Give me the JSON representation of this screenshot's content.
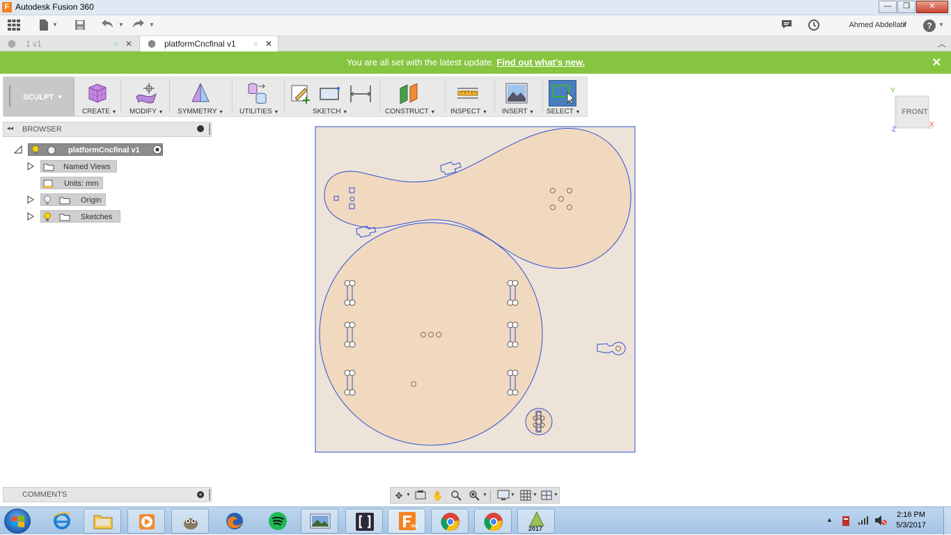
{
  "window": {
    "app_title": "Autodesk Fusion 360",
    "logo_letter": "F",
    "minimize": "—",
    "maximize": "❐",
    "close": "✕"
  },
  "qat": {
    "user_name": "Ahmed Abdellatif",
    "help": "?"
  },
  "tabs": [
    {
      "label": "1 v1",
      "active": false
    },
    {
      "label": "platformCncfinal v1",
      "active": true
    }
  ],
  "banner": {
    "message": "You are all set with the latest update.",
    "link": "Find out what's new.",
    "close": "✕"
  },
  "ribbon": {
    "workspace": "SCULPT",
    "groups": {
      "create": "CREATE",
      "modify": "MODIFY",
      "symmetry": "SYMMETRY",
      "utilities": "UTILITIES",
      "sketch": "SKETCH",
      "construct": "CONSTRUCT",
      "inspect": "INSPECT",
      "insert": "INSERT",
      "select": "SELECT"
    }
  },
  "browser": {
    "title": "BROWSER",
    "root": "platformCncfinal v1",
    "items": [
      {
        "label": "Named Views"
      },
      {
        "label": "Units: mm"
      },
      {
        "label": "Origin"
      },
      {
        "label": "Sketches"
      }
    ]
  },
  "comments": {
    "title": "COMMENTS"
  },
  "viewcube": {
    "face": "FRONT",
    "axis_y": "Y",
    "axis_x": "X",
    "axis_z": "Z"
  },
  "taskbar": {
    "time": "2:16 PM",
    "date": "5/3/2017",
    "version_badge": "2017",
    "fusion_badge": "360"
  },
  "colors": {
    "banner": "#87c540",
    "sketch_line": "#2e4fd4",
    "profile_fill": "#f1d9bf",
    "canvas_fill": "#ede3d8",
    "accent_orange": "#f58220"
  },
  "icons": [
    "apps-grid-icon",
    "file-icon",
    "save-icon",
    "undo-icon",
    "redo-icon",
    "notifications-icon",
    "history-icon",
    "help-icon",
    "orbit-icon",
    "pan-icon",
    "zoom-icon",
    "display-icon",
    "grid-icon"
  ]
}
